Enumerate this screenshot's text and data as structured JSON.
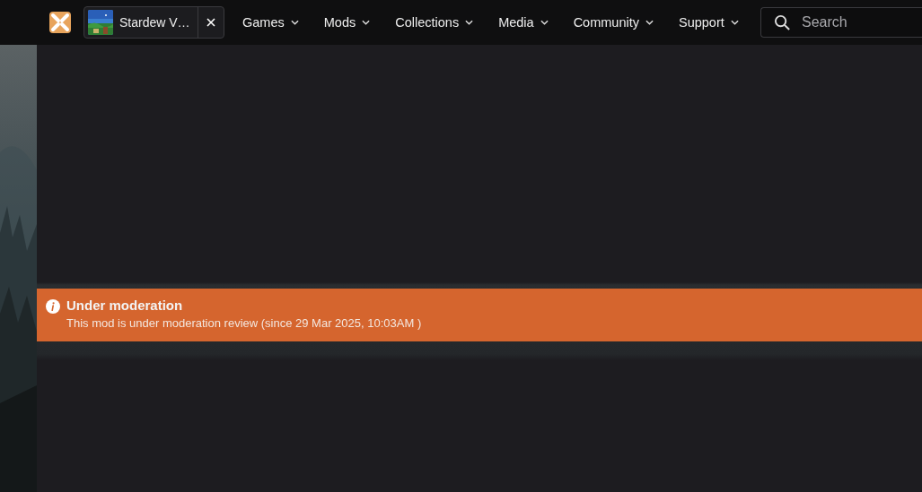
{
  "header": {
    "game_tab": {
      "title": "Stardew V…"
    },
    "nav": [
      {
        "label": "Games"
      },
      {
        "label": "Mods"
      },
      {
        "label": "Collections"
      },
      {
        "label": "Media"
      },
      {
        "label": "Community"
      },
      {
        "label": "Support"
      }
    ],
    "search": {
      "placeholder": "Search"
    }
  },
  "notice": {
    "kind": "warning",
    "title": "Under moderation",
    "message": "This mod is under moderation review (since 29 Mar 2025, 10:03AM )"
  }
}
